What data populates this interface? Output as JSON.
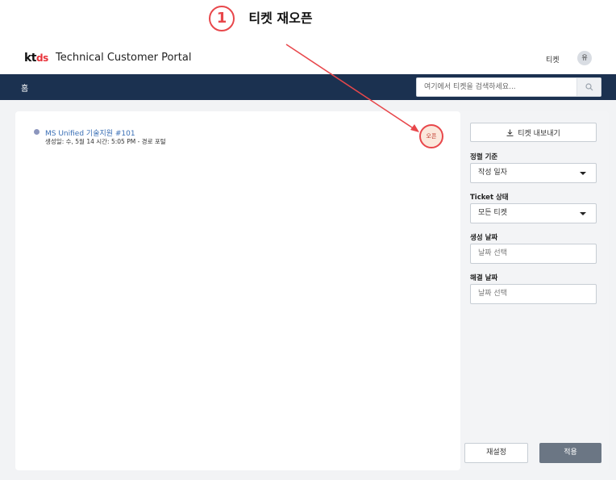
{
  "annotation": {
    "number": "1",
    "label": "티켓 재오픈"
  },
  "header": {
    "logo_kt": "kt",
    "logo_ds": "ds",
    "title": "Technical Customer Portal",
    "nav_ticket": "티켓",
    "avatar_initial": "유"
  },
  "nav": {
    "home": "홈",
    "search_placeholder": "여기에서 티켓을 검색하세요..."
  },
  "tickets": [
    {
      "title": "MS Unified 기술지원 #101",
      "meta": "생성일: 수, 5월 14 시간: 5:05 PM - 경로 포털",
      "badge": "오픈"
    }
  ],
  "filters": {
    "export_label": "티켓 내보내기",
    "sort_label": "정렬 기준",
    "sort_value": "작성 일자",
    "status_label": "Ticket 상태",
    "status_value": "모든 티켓",
    "created_label": "생성 날짜",
    "created_placeholder": "날짜 선택",
    "resolved_label": "해결 날짜",
    "resolved_placeholder": "날짜 선택",
    "reset_label": "재설정",
    "apply_label": "적용"
  },
  "colors": {
    "navbar": "#1b3150",
    "annotation_red": "#e8474b",
    "link_blue": "#3a6fb5",
    "apply_bg": "#6b7684"
  }
}
